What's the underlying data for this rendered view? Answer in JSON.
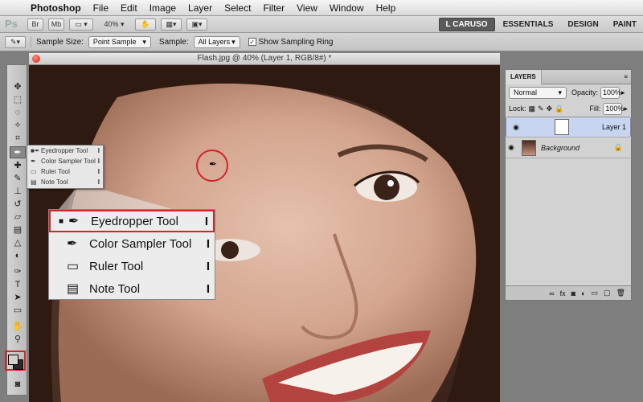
{
  "menubar": {
    "items": [
      "Photoshop",
      "File",
      "Edit",
      "Image",
      "Layer",
      "Select",
      "Filter",
      "View",
      "Window",
      "Help"
    ]
  },
  "appbar": {
    "logo": "Ps",
    "bridge": "Br",
    "mini_bridge": "Mb",
    "zoom": "40%",
    "workspaces": [
      "L CARUSO",
      "ESSENTIALS",
      "DESIGN",
      "PAINT"
    ]
  },
  "options": {
    "sample_size_label": "Sample Size:",
    "sample_size_value": "Point Sample",
    "sample_label": "Sample:",
    "sample_value": "All Layers",
    "ring_label": "Show Sampling Ring"
  },
  "document": {
    "title": "Flash.jpg @ 40% (Layer 1, RGB/8#) *"
  },
  "flyout": {
    "items": [
      {
        "label": "Eyedropper Tool",
        "key": "I"
      },
      {
        "label": "Color Sampler Tool",
        "key": "I"
      },
      {
        "label": "Ruler Tool",
        "key": "I"
      },
      {
        "label": "Note Tool",
        "key": "I"
      }
    ]
  },
  "layers": {
    "tab_label": "LAYERS",
    "blend_mode": "Normal",
    "opacity_label": "Opacity:",
    "opacity_value": "100%",
    "lock_label": "Lock:",
    "fill_label": "Fill:",
    "fill_value": "100%",
    "items": [
      {
        "name": "Layer 1",
        "selected": true
      },
      {
        "name": "Background",
        "selected": false
      }
    ],
    "footer_icons": [
      "link-icon",
      "fx-icon",
      "mask-icon",
      "adjustment-icon",
      "group-icon",
      "new-layer-icon",
      "trash-icon"
    ]
  },
  "colors": {
    "highlight_red": "#d3232b",
    "foreground": "#d5d0c9",
    "background": "#2a2a2a"
  }
}
